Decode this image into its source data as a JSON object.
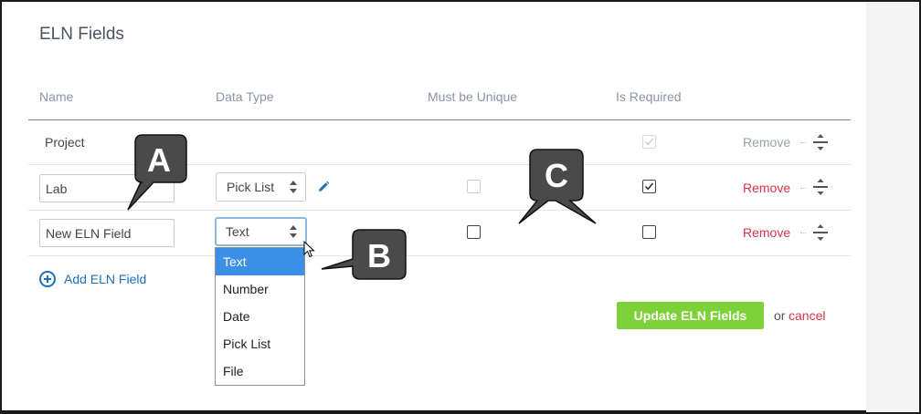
{
  "title": "ELN Fields",
  "columns": {
    "name": "Name",
    "data_type": "Data Type",
    "must_be_unique": "Must be Unique",
    "is_required": "Is Required"
  },
  "rows": [
    {
      "name": "Project",
      "data_type": "",
      "must_be_unique": null,
      "is_required": true,
      "is_required_disabled": true,
      "remove": "Remove",
      "remove_active": false
    },
    {
      "name": "Lab",
      "data_type": "Pick List",
      "must_be_unique": false,
      "is_required": true,
      "remove": "Remove",
      "remove_active": true
    },
    {
      "name": "New ELN Field",
      "data_type": "Text",
      "must_be_unique": false,
      "is_required": false,
      "remove": "Remove",
      "remove_active": true
    }
  ],
  "dropdown": {
    "options": [
      "Text",
      "Number",
      "Date",
      "Pick List",
      "File"
    ],
    "selected": "Text"
  },
  "add_link": "Add ELN Field",
  "update_button": "Update ELN Fields",
  "or_text": "or",
  "cancel_link": "cancel",
  "callouts": [
    "A",
    "B",
    "C"
  ],
  "colors": {
    "accent_blue": "#1f6fb8",
    "remove_red": "#d9334c",
    "update_green": "#7dd13a",
    "dropdown_highlight": "#3c8fe6",
    "callout_fill": "#4a4a4a"
  },
  "icons": [
    "pencil-icon",
    "drag-handle-icon",
    "plus-circle-icon",
    "mouse-cursor-icon",
    "checkmark-icon"
  ]
}
